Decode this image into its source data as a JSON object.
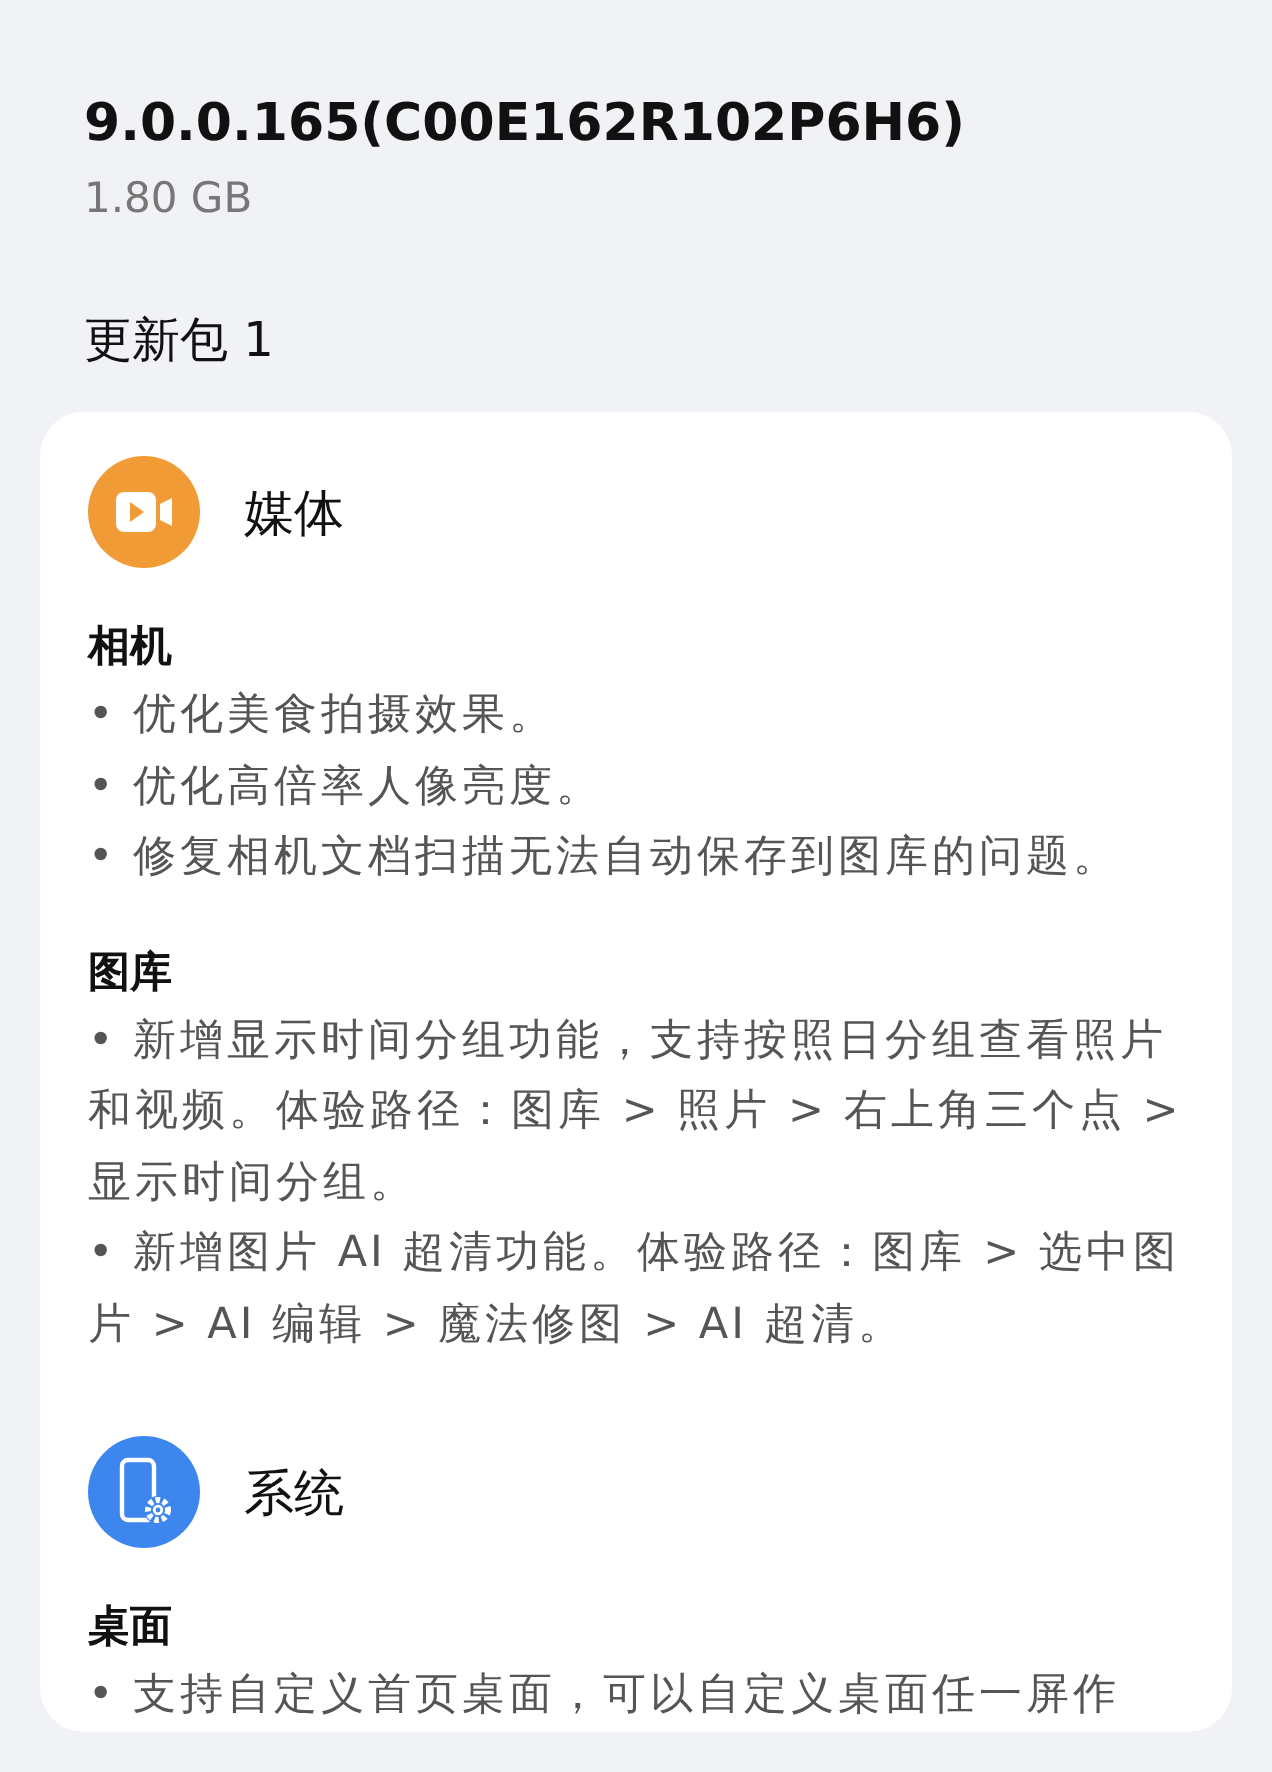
{
  "version": "9.0.0.165(C00E162R102P6H6)",
  "size": "1.80 GB",
  "package_title": "更新包 1",
  "groups": [
    {
      "kind": "media",
      "title": "媒体",
      "sections": [
        {
          "title": "相机",
          "items": [
            "• 优化美食拍摄效果。",
            "• 优化高倍率人像亮度。",
            "• 修复相机文档扫描无法自动保存到图库的问题。"
          ]
        },
        {
          "title": "图库",
          "items": [
            "• 新增显示时间分组功能，支持按照日分组查看照片和视频。体验路径：图库 > 照片 > 右上角三个点 > 显示时间分组。",
            "• 新增图片 AI 超清功能。体验路径：图库 > 选中图片 > AI 编辑 > 魔法修图 > AI 超清。"
          ]
        }
      ]
    },
    {
      "kind": "system",
      "title": "系统",
      "sections": [
        {
          "title": "桌面",
          "items": [
            "• 支持自定义首页桌面，可以自定义桌面任一屏作"
          ]
        }
      ]
    }
  ]
}
